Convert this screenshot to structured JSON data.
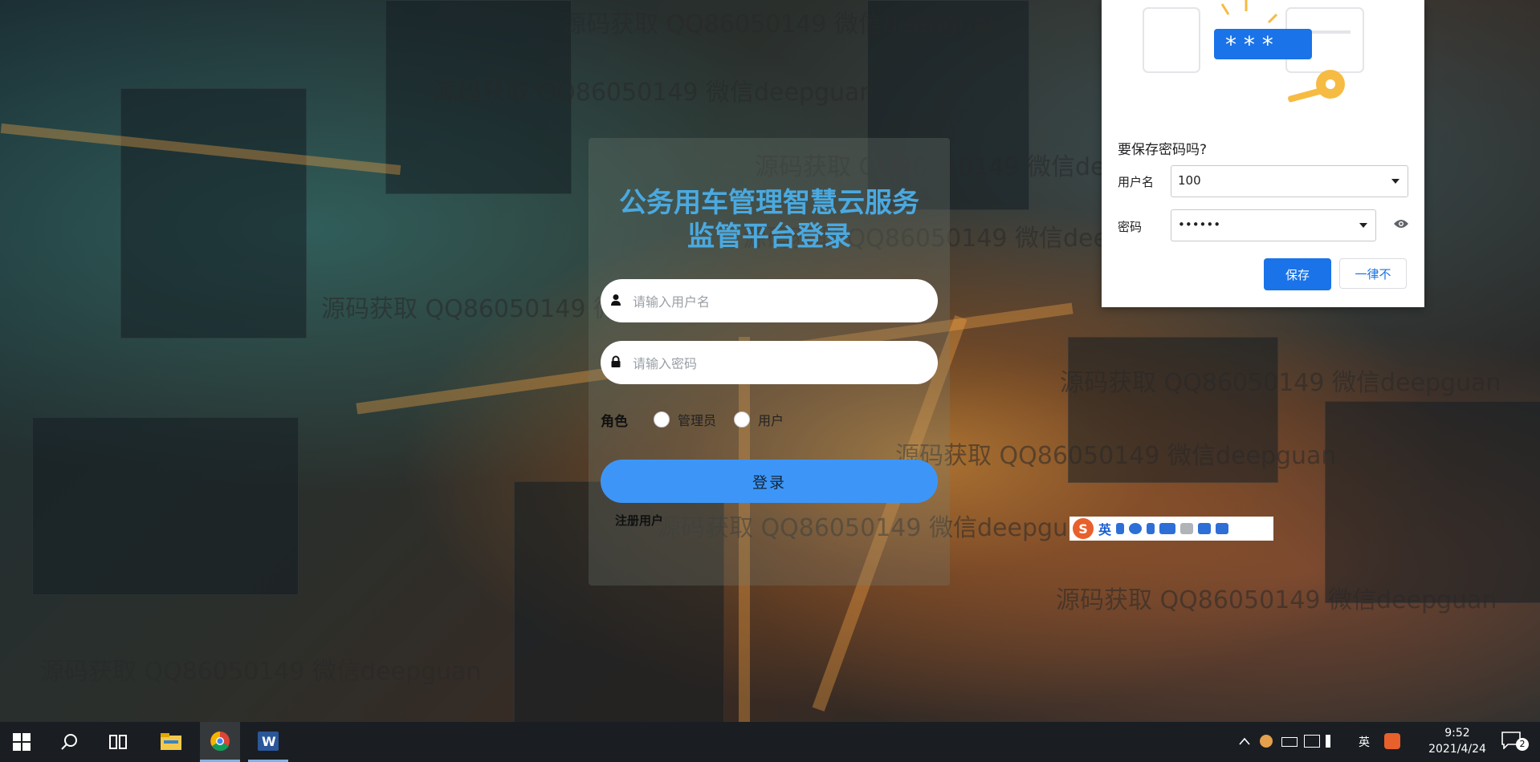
{
  "watermark": "源码获取 QQ86050149 微信deepguan",
  "login": {
    "title_line1": "公务用车管理智慧云服务",
    "title_line2": "监管平台登录",
    "username_placeholder": "请输入用户名",
    "password_placeholder": "请输入密码",
    "role_label": "角色",
    "role_options": [
      "管理员",
      "用户"
    ],
    "login_button": "登录",
    "register_link": "注册用户"
  },
  "save_password": {
    "question": "要保存密码吗?",
    "username_label": "用户名",
    "username_value": "100",
    "password_label": "密码",
    "password_value": "••••••",
    "save_button": "保存",
    "never_button": "一律不"
  },
  "ime": {
    "lang": "英"
  },
  "taskbar": {
    "tray_lang": "英",
    "time": "9:52",
    "date": "2021/4/24",
    "notification_count": "2"
  },
  "colors": {
    "accent": "#3d96f7",
    "title": "#4aa9e0",
    "save_blue": "#1a73e8"
  }
}
